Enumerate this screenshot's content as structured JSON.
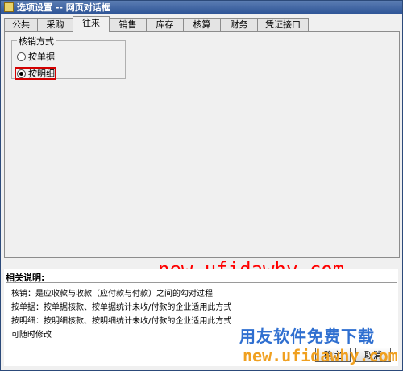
{
  "window": {
    "title": "选项设置 -- 网页对话框"
  },
  "tabs": [
    {
      "label": "公共"
    },
    {
      "label": "采购"
    },
    {
      "label": "往来"
    },
    {
      "label": "销售"
    },
    {
      "label": "库存"
    },
    {
      "label": "核算"
    },
    {
      "label": "财务"
    },
    {
      "label": "凭证接口"
    }
  ],
  "active_tab": "往来",
  "group": {
    "title": "核销方式",
    "options": [
      {
        "label": "按单据",
        "checked": false
      },
      {
        "label": "按明细",
        "checked": true
      }
    ]
  },
  "watermark": {
    "url_center": "new.ufidawhy.com",
    "brand_cn": "用友软件免费下载",
    "url_bottom": "new.ufidawhy.com"
  },
  "notes": {
    "title": "相关说明:",
    "lines": [
      "核销：是应收款与收款（应付款与付款）之间的勾对过程",
      "按单据：按单据核款、按单据统计未收/付款的企业适用此方式",
      "按明细：按明细核款、按明细统计未收/付款的企业适用此方式",
      "可随时修改"
    ]
  },
  "buttons": {
    "ok": "确定",
    "cancel": "取消"
  },
  "colors": {
    "titlebar": "#2f5597",
    "highlight": "#d40000",
    "watermark_red": "#ff0000",
    "watermark_blue": "#2f6fd0",
    "watermark_orange": "#f0a020"
  }
}
